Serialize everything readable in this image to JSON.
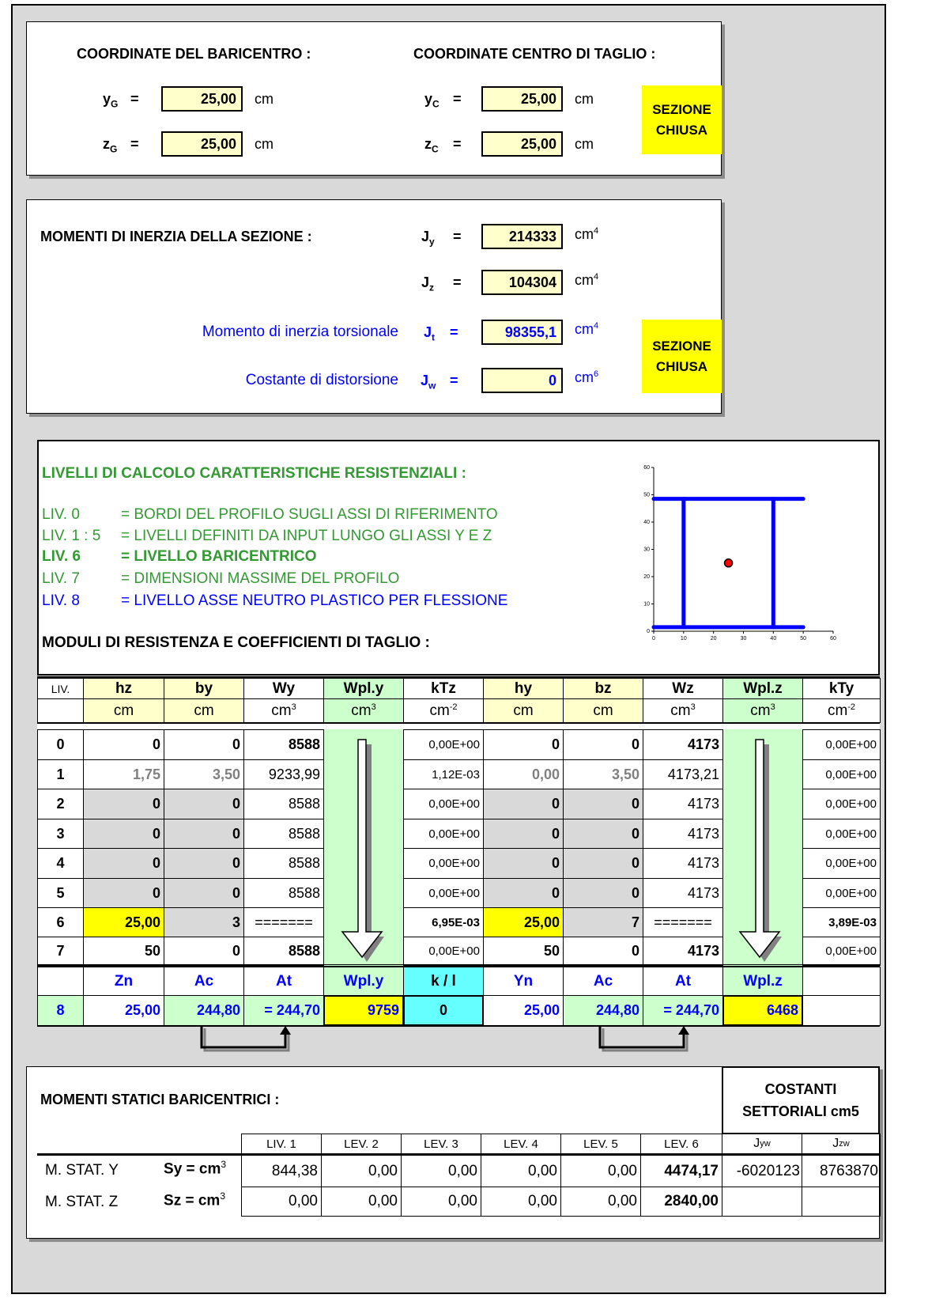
{
  "baricentro": {
    "title": "COORDINATE DEL BARICENTRO :",
    "yG": {
      "sym": "y",
      "sub": "G",
      "eq": "=",
      "value": "25,00",
      "unit": "cm"
    },
    "zG": {
      "sym": "z",
      "sub": "G",
      "eq": "=",
      "value": "25,00",
      "unit": "cm"
    }
  },
  "taglio": {
    "title": "COORDINATE CENTRO DI TAGLIO :",
    "yC": {
      "sym": "y",
      "sub": "C",
      "eq": "=",
      "value": "25,00",
      "unit": "cm"
    },
    "zC": {
      "sym": "z",
      "sub": "C",
      "eq": "=",
      "value": "25,00",
      "unit": "cm"
    },
    "badge_l1": "SEZIONE",
    "badge_l2": "CHIUSA"
  },
  "inerzia": {
    "title": "MOMENTI DI INERZIA DELLA SEZIONE :",
    "Jy": {
      "sym": "J",
      "sub": "y",
      "eq": "=",
      "value": "214333",
      "unit": "cm",
      "exp": "4"
    },
    "Jz": {
      "sym": "J",
      "sub": "z",
      "eq": "=",
      "value": "104304",
      "unit": "cm",
      "exp": "4"
    },
    "Jt": {
      "label": "Momento di inerzia torsionale",
      "sym": "J",
      "sub": "t",
      "eq": "=",
      "value": "98355,1",
      "unit": "cm",
      "exp": "4"
    },
    "Jw": {
      "label": "Costante di distorsione",
      "sym": "J",
      "sub": "w",
      "eq": "=",
      "value": "0",
      "unit": "cm",
      "exp": "6"
    },
    "badge_l1": "SEZIONE",
    "badge_l2": "CHIUSA"
  },
  "livelli": {
    "title": "LIVELLI DI CALCOLO CARATTERISTICHE RESISTENZIALI :",
    "items": [
      {
        "code": "LIV. 0",
        "text": "=  BORDI DEL PROFILO SUGLI ASSI DI RIFERIMENTO"
      },
      {
        "code": "LIV. 1 : 5",
        "text": "=  LIVELLI DEFINITI DA INPUT LUNGO GLI ASSI Y E Z"
      },
      {
        "code": "LIV. 6",
        "text": "=  LIVELLO BARICENTRICO"
      },
      {
        "code": "LIV. 7",
        "text": "=  DIMENSIONI MASSIME DEL PROFILO"
      },
      {
        "code": "LIV. 8",
        "text": "=  LIVELLO ASSE NEUTRO PLASTICO PER FLESSIONE"
      }
    ],
    "moduli_title": "MODULI DI RESISTENZA E COEFFICIENTI DI TAGLIO :"
  },
  "colors": {
    "input": "#ffffcc",
    "highlight": "#ffff00",
    "green_cell": "#ccffcc",
    "cyan_cell": "#66ffff",
    "gray_cell": "#d9d9d9",
    "green_text": "#339933",
    "blue_text": "#0000ff"
  },
  "table": {
    "headers": [
      "LIV.",
      "hz",
      "by",
      "Wy",
      "Wpl.y",
      "kTz",
      "hy",
      "bz",
      "Wz",
      "Wpl.z",
      "kTy"
    ],
    "units": [
      {
        "u": "",
        "e": ""
      },
      {
        "u": "cm",
        "e": ""
      },
      {
        "u": "cm",
        "e": ""
      },
      {
        "u": "cm",
        "e": "3"
      },
      {
        "u": "cm",
        "e": "3"
      },
      {
        "u": "cm",
        "e": "-2"
      },
      {
        "u": "cm",
        "e": ""
      },
      {
        "u": "cm",
        "e": ""
      },
      {
        "u": "cm",
        "e": "3"
      },
      {
        "u": "cm",
        "e": "3"
      },
      {
        "u": "cm",
        "e": "-2"
      }
    ],
    "rows": [
      [
        "0",
        "0",
        "0",
        "8588",
        "",
        "0,00E+00",
        "0",
        "0",
        "4173",
        "",
        "0,00E+00"
      ],
      [
        "1",
        "1,75",
        "3,50",
        "9233,99",
        "",
        "1,12E-03",
        "0,00",
        "3,50",
        "4173,21",
        "",
        "0,00E+00"
      ],
      [
        "2",
        "0",
        "0",
        "8588",
        "",
        "0,00E+00",
        "0",
        "0",
        "4173",
        "",
        "0,00E+00"
      ],
      [
        "3",
        "0",
        "0",
        "8588",
        "",
        "0,00E+00",
        "0",
        "0",
        "4173",
        "",
        "0,00E+00"
      ],
      [
        "4",
        "0",
        "0",
        "8588",
        "",
        "0,00E+00",
        "0",
        "0",
        "4173",
        "",
        "0,00E+00"
      ],
      [
        "5",
        "0",
        "0",
        "8588",
        "",
        "0,00E+00",
        "0",
        "0",
        "4173",
        "",
        "0,00E+00"
      ],
      [
        "6",
        "25,00",
        "3",
        "=======",
        "",
        "6,95E-03",
        "25,00",
        "7",
        "=======",
        "",
        "3,89E-03"
      ],
      [
        "7",
        "50",
        "0",
        "8588",
        "",
        "0,00E+00",
        "50",
        "0",
        "4173",
        "",
        "0,00E+00"
      ]
    ],
    "plastic_headers": [
      "",
      "Zn",
      "Ac",
      "At",
      "Wpl.y",
      "k / l",
      "Yn",
      "Ac",
      "At",
      "Wpl.z",
      ""
    ],
    "plastic_row": [
      "8",
      "25,00",
      "244,80",
      "= 244,70",
      "9759",
      "0",
      "25,00",
      "244,80",
      "= 244,70",
      "6468",
      ""
    ]
  },
  "statici": {
    "title": "MOMENTI STATICI BARICENTRICI :",
    "settoriali_l1": "COSTANTI",
    "settoriali_l2": "SETTORIALI cm5",
    "headers": [
      "LIV. 1",
      "LEV. 2",
      "LEV. 3",
      "LEV. 4",
      "LEV. 5",
      "LEV. 6"
    ],
    "jyw": {
      "sym": "J",
      "sub": "yw"
    },
    "jzw": {
      "sym": "J",
      "sub": "zw"
    },
    "rows": [
      {
        "label": "M. STAT.  Y",
        "sym": "S",
        "symrest": "y = cm",
        "exp": "3",
        "values": [
          "844,38",
          "0,00",
          "0,00",
          "0,00",
          "0,00",
          "4474,17"
        ],
        "jyw": "-6020123",
        "jzw": "8763870"
      },
      {
        "label": "M. STAT.  Z",
        "sym": "S",
        "symrest": "z = cm",
        "exp": "3",
        "values": [
          "0,00",
          "0,00",
          "0,00",
          "0,00",
          "0,00",
          "2840,00"
        ],
        "jyw": "",
        "jzw": ""
      }
    ]
  },
  "chart_data": {
    "type": "line",
    "xlim": [
      0,
      60
    ],
    "ylim": [
      0,
      60
    ],
    "x_ticks": [
      "0",
      "10",
      "20",
      "30",
      "40",
      "50",
      "60"
    ],
    "y_ticks": [
      "0",
      "10",
      "20",
      "30",
      "40",
      "50",
      "60"
    ],
    "grid": false,
    "series": [
      {
        "color": "#0000ff",
        "x": [
          0,
          50
        ],
        "y": [
          48.5,
          48.5
        ]
      },
      {
        "color": "#0000ff",
        "x": [
          0,
          50
        ],
        "y": [
          1.5,
          1.5
        ]
      },
      {
        "color": "#0000ff",
        "x": [
          10,
          10
        ],
        "y": [
          1.5,
          48.5
        ]
      },
      {
        "color": "#0000ff",
        "x": [
          40,
          40
        ],
        "y": [
          1.5,
          48.5
        ]
      }
    ],
    "points": [
      {
        "color": "#ff0000",
        "x": 25,
        "y": 25
      }
    ]
  }
}
